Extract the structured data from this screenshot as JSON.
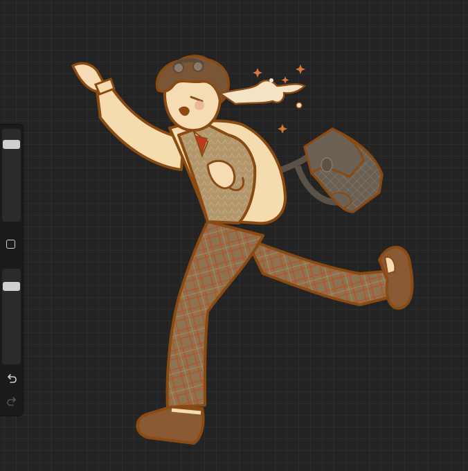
{
  "app": {
    "canvas_grid": "on",
    "colors": {
      "canvas_bg": "#232323",
      "grid_line": "#2c2c2c",
      "sidebar_bg": "#1b1b1b",
      "slider_thumb": "#cfcfcf",
      "ink_brown": "#8a4a12",
      "skin": "#f6dcb4",
      "shirt": "#f5dcae",
      "vest": "#b0946a",
      "pants": "#8a7152",
      "bag": "#635a4e"
    }
  },
  "sidebar": {
    "brush_size_level": 0.13,
    "opacity_level": 0.15,
    "icons": {
      "modify": "square-icon",
      "undo": "undo-icon",
      "redo": "redo-icon"
    }
  }
}
